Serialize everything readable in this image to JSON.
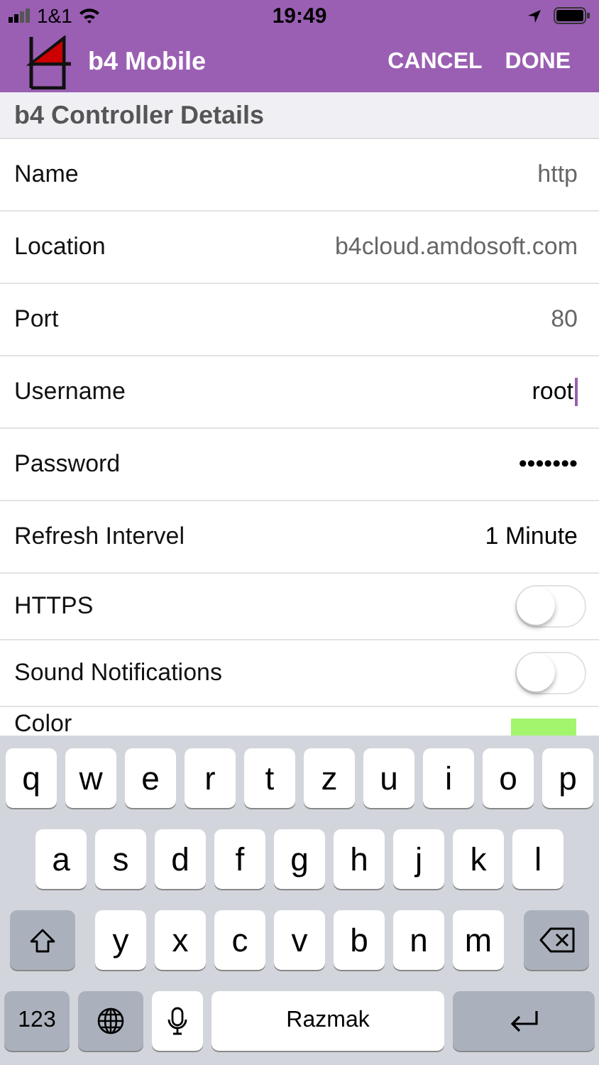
{
  "status_bar": {
    "carrier": "1&1",
    "time": "19:49"
  },
  "header": {
    "title": "b4 Mobile",
    "actions": [
      "CANCEL",
      "DONE"
    ]
  },
  "section": {
    "title": "b4 Controller Details"
  },
  "rows": [
    {
      "kind": "text",
      "label": "Name",
      "value": "http",
      "focused": false,
      "muted": true
    },
    {
      "kind": "text",
      "label": "Location",
      "value": "b4cloud.amdosoft.com",
      "focused": false,
      "muted": true
    },
    {
      "kind": "text",
      "label": "Port",
      "value": "80",
      "focused": false,
      "muted": true
    },
    {
      "kind": "text",
      "label": "Username",
      "value": "root",
      "focused": true,
      "muted": false
    },
    {
      "kind": "text",
      "label": "Password",
      "value": "•••••••",
      "focused": false,
      "muted": false
    },
    {
      "kind": "text",
      "label": "Refresh Intervel",
      "value": "1 Minute",
      "focused": false,
      "muted": false
    },
    {
      "kind": "toggle",
      "label": "HTTPS",
      "on": false
    },
    {
      "kind": "toggle",
      "label": "Sound Notifications",
      "on": false
    },
    {
      "kind": "color",
      "label": "Color",
      "color": "#a3f56e"
    }
  ],
  "keyboard": {
    "rows": [
      {
        "keys": [
          {
            "kind": "letter",
            "label": "q"
          },
          {
            "kind": "letter",
            "label": "w"
          },
          {
            "kind": "letter",
            "label": "e"
          },
          {
            "kind": "letter",
            "label": "r"
          },
          {
            "kind": "letter",
            "label": "t"
          },
          {
            "kind": "letter",
            "label": "z"
          },
          {
            "kind": "letter",
            "label": "u"
          },
          {
            "kind": "letter",
            "label": "i"
          },
          {
            "kind": "letter",
            "label": "o"
          },
          {
            "kind": "letter",
            "label": "p"
          }
        ]
      },
      {
        "keys": [
          {
            "kind": "letter",
            "label": "a"
          },
          {
            "kind": "letter",
            "label": "s"
          },
          {
            "kind": "letter",
            "label": "d"
          },
          {
            "kind": "letter",
            "label": "f"
          },
          {
            "kind": "letter",
            "label": "g"
          },
          {
            "kind": "letter",
            "label": "h"
          },
          {
            "kind": "letter",
            "label": "j"
          },
          {
            "kind": "letter",
            "label": "k"
          },
          {
            "kind": "letter",
            "label": "l"
          }
        ]
      },
      {
        "keys": [
          {
            "kind": "shift"
          },
          {
            "kind": "letter",
            "label": "y"
          },
          {
            "kind": "letter",
            "label": "x"
          },
          {
            "kind": "letter",
            "label": "c"
          },
          {
            "kind": "letter",
            "label": "v"
          },
          {
            "kind": "letter",
            "label": "b"
          },
          {
            "kind": "letter",
            "label": "n"
          },
          {
            "kind": "letter",
            "label": "m"
          },
          {
            "kind": "backspace"
          }
        ]
      },
      {
        "keys": [
          {
            "kind": "numbers",
            "label": "123"
          },
          {
            "kind": "globe"
          },
          {
            "kind": "mic"
          },
          {
            "kind": "space",
            "label": "Razmak"
          },
          {
            "kind": "return"
          }
        ]
      }
    ]
  }
}
